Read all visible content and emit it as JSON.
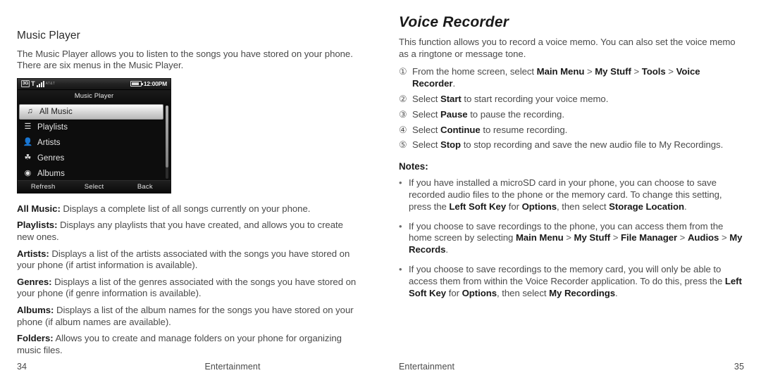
{
  "left_page": {
    "section_title": "Music Player",
    "intro": "The Music Player allows you to listen to the songs you have stored on your phone. There are six menus in the Music Player.",
    "phone_screenshot": {
      "status_bar": {
        "network_badge": "3G",
        "signal_label": "T",
        "carrier": "AT&T",
        "clock": "12:00PM",
        "battery_icon": "battery-icon",
        "signal_icon": "signal-bars-icon"
      },
      "screen_title": "Music Player",
      "menu_items": [
        {
          "label": "All Music",
          "icon": "music-note-icon",
          "selected": true
        },
        {
          "label": "Playlists",
          "icon": "list-icon",
          "selected": false
        },
        {
          "label": "Artists",
          "icon": "person-icon",
          "selected": false
        },
        {
          "label": "Genres",
          "icon": "genre-icon",
          "selected": false
        },
        {
          "label": "Albums",
          "icon": "disc-icon",
          "selected": false
        }
      ],
      "soft_keys": {
        "left": "Refresh",
        "center": "Select",
        "right": "Back"
      }
    },
    "definitions": [
      {
        "term": "All Music:",
        "text": " Displays a complete list of all songs currently on your phone."
      },
      {
        "term": "Playlists:",
        "text": " Displays any playlists that you have created, and allows you to create new ones."
      },
      {
        "term": "Artists:",
        "text": " Displays a list of the artists associated with the songs you have stored on your phone (if artist information is available)."
      },
      {
        "term": "Genres:",
        "text": " Displays a list of the genres associated with the songs you have stored on your phone (if genre information is available)."
      },
      {
        "term": "Albums:",
        "text": " Displays a list of the album names for the songs you have stored on your phone (if album names are available)."
      },
      {
        "term": "Folders:",
        "text": " Allows you to create and manage folders on your phone for organizing music files."
      }
    ],
    "footer": {
      "page_number": "34",
      "chapter_label": "Entertainment"
    }
  },
  "right_page": {
    "chapter_title": "Voice Recorder",
    "intro": "This function allows you to record a voice memo. You can also set the voice memo as a ringtone or message tone.",
    "steps": [
      {
        "number": "①",
        "parts": [
          {
            "t": "From the home screen, select ",
            "b": false
          },
          {
            "t": "Main Menu",
            "b": true
          },
          {
            "t": " > ",
            "b": false,
            "sep": true
          },
          {
            "t": "My Stuff",
            "b": true
          },
          {
            "t": " > ",
            "b": false,
            "sep": true
          },
          {
            "t": "Tools",
            "b": true
          },
          {
            "t": " > ",
            "b": false,
            "sep": true
          },
          {
            "t": "Voice Recorder",
            "b": true
          },
          {
            "t": ".",
            "b": false
          }
        ]
      },
      {
        "number": "②",
        "parts": [
          {
            "t": "Select ",
            "b": false
          },
          {
            "t": "Start",
            "b": true
          },
          {
            "t": " to start recording your voice memo.",
            "b": false
          }
        ]
      },
      {
        "number": "③",
        "parts": [
          {
            "t": "Select ",
            "b": false
          },
          {
            "t": "Pause",
            "b": true
          },
          {
            "t": " to pause the recording.",
            "b": false
          }
        ]
      },
      {
        "number": "④",
        "parts": [
          {
            "t": "Select ",
            "b": false
          },
          {
            "t": "Continue",
            "b": true
          },
          {
            "t": " to resume recording.",
            "b": false
          }
        ]
      },
      {
        "number": "⑤",
        "parts": [
          {
            "t": "Select ",
            "b": false
          },
          {
            "t": "Stop",
            "b": true
          },
          {
            "t": " to stop recording and save the new audio file to My Recordings.",
            "b": false
          }
        ]
      }
    ],
    "notes_title": "Notes:",
    "notes_bullet": "•",
    "notes": [
      {
        "parts": [
          {
            "t": "If you have installed a microSD card in your phone, you can choose to save recorded audio files to the phone or the memory card. To change this setting, press the ",
            "b": false
          },
          {
            "t": "Left Soft Key",
            "b": true
          },
          {
            "t": " for ",
            "b": false
          },
          {
            "t": "Options",
            "b": true
          },
          {
            "t": ", then select ",
            "b": false
          },
          {
            "t": "Storage Location",
            "b": true
          },
          {
            "t": ".",
            "b": false
          }
        ]
      },
      {
        "parts": [
          {
            "t": "If you choose to save recordings to the phone, you can access them from the home screen by selecting ",
            "b": false
          },
          {
            "t": "Main Menu",
            "b": true
          },
          {
            "t": " > ",
            "b": false,
            "sep": true
          },
          {
            "t": "My Stuff",
            "b": true
          },
          {
            "t": " > ",
            "b": false,
            "sep": true
          },
          {
            "t": "File Manager",
            "b": true
          },
          {
            "t": " > ",
            "b": false,
            "sep": true
          },
          {
            "t": "Audios",
            "b": true
          },
          {
            "t": " > ",
            "b": false,
            "sep": true
          },
          {
            "t": "My Records",
            "b": true
          },
          {
            "t": ".",
            "b": false
          }
        ]
      },
      {
        "parts": [
          {
            "t": "If you choose to save recordings to the memory card, you will only be able to access them from within the Voice Recorder application. To do this, press the ",
            "b": false
          },
          {
            "t": "Left Soft Key",
            "b": true
          },
          {
            "t": " for ",
            "b": false
          },
          {
            "t": "Options",
            "b": true
          },
          {
            "t": ", then select ",
            "b": false
          },
          {
            "t": "My Recordings",
            "b": true
          },
          {
            "t": ".",
            "b": false
          }
        ]
      }
    ],
    "footer": {
      "page_number": "35",
      "chapter_label": "Entertainment"
    }
  },
  "colors": {
    "page_background": "#ffffff",
    "body_text": "#4a4a4a",
    "heading_text": "#1a1a1a",
    "phone_screen_background": "#0d0d0d",
    "phone_selected_item": "#d6d6d6"
  }
}
